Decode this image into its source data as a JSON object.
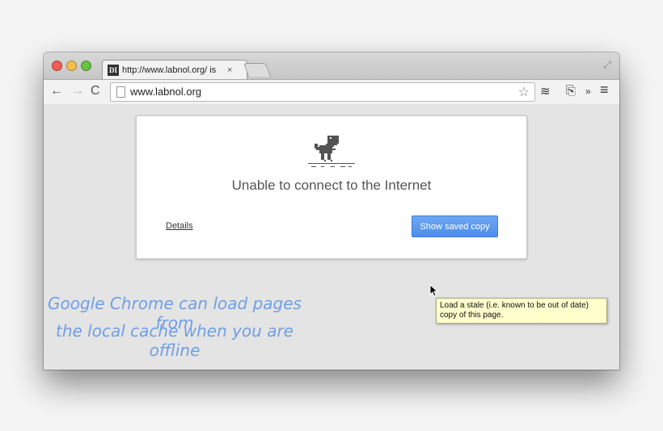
{
  "tab": {
    "favicon": "DI",
    "title": "http://www.labnol.org/ is",
    "close": "×"
  },
  "toolbar": {
    "back_icon": "←",
    "forward_icon": "→",
    "reload_icon": "C",
    "url": "www.labnol.org",
    "star_icon": "☆",
    "buffer_icon": "≋",
    "lock_icon": "⎘",
    "overflow_icon": "»",
    "menu_icon": "≡"
  },
  "error": {
    "headline": "Unable to connect to the Internet",
    "details_label": "Details",
    "button_label": "Show saved copy",
    "tooltip": "Load a stale (i.e. known to be out of date) copy of this page."
  },
  "caption": {
    "line1": "Google Chrome can load pages from",
    "line2": "the local cache when you are offline"
  },
  "colors": {
    "accent": "#4d8ee9",
    "caption": "#6f9fe6",
    "tooltip_bg": "#ffffcc"
  }
}
